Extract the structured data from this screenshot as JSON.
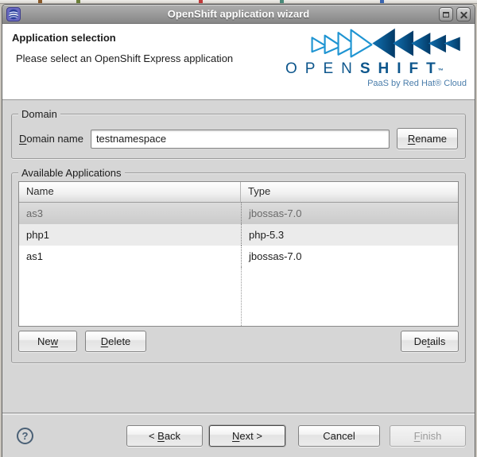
{
  "window": {
    "title": "OpenShift application wizard"
  },
  "header": {
    "title": "Application selection",
    "subtitle": "Please select an OpenShift Express application",
    "logo": {
      "open": "OPEN",
      "shift": "SHIFT",
      "tm": "™",
      "tagline": "PaaS by Red Hat® Cloud"
    }
  },
  "domain": {
    "legend": "Domain",
    "label": {
      "pre": "",
      "key": "D",
      "post": "omain name"
    },
    "input_value": "testnamespace",
    "rename_button": {
      "pre": "",
      "key": "R",
      "post": "ename"
    }
  },
  "applications": {
    "legend": "Available Applications",
    "columns": [
      "Name",
      "Type"
    ],
    "rows": [
      {
        "name": "as3",
        "type": "jbossas-7.0",
        "selected": true
      },
      {
        "name": "php1",
        "type": "php-5.3",
        "selected": false
      },
      {
        "name": "as1",
        "type": "jbossas-7.0",
        "selected": false
      }
    ],
    "new_button": {
      "pre": "Ne",
      "key": "w",
      "post": ""
    },
    "delete_button": {
      "pre": "",
      "key": "D",
      "post": "elete"
    },
    "details_button": {
      "pre": "De",
      "key": "t",
      "post": "ails"
    }
  },
  "footer": {
    "help": "?",
    "back_button": {
      "pre": "< ",
      "key": "B",
      "post": "ack"
    },
    "next_button": {
      "pre": "",
      "key": "N",
      "post": "ext >"
    },
    "cancel_button": {
      "pre": "Cancel",
      "key": "",
      "post": ""
    },
    "finish_button": {
      "pre": "",
      "key": "F",
      "post": "inish"
    }
  },
  "colors": {
    "logo_outline_blue": "#1e94d2",
    "logo_fill_light": "#1173b3",
    "logo_fill_dark": "#033a67",
    "logo_text_blue": "#0d568c",
    "tagline_blue": "#4a7dab",
    "help_icon_blue": "#4a6076",
    "selection_gray": "#cfcfcf"
  }
}
